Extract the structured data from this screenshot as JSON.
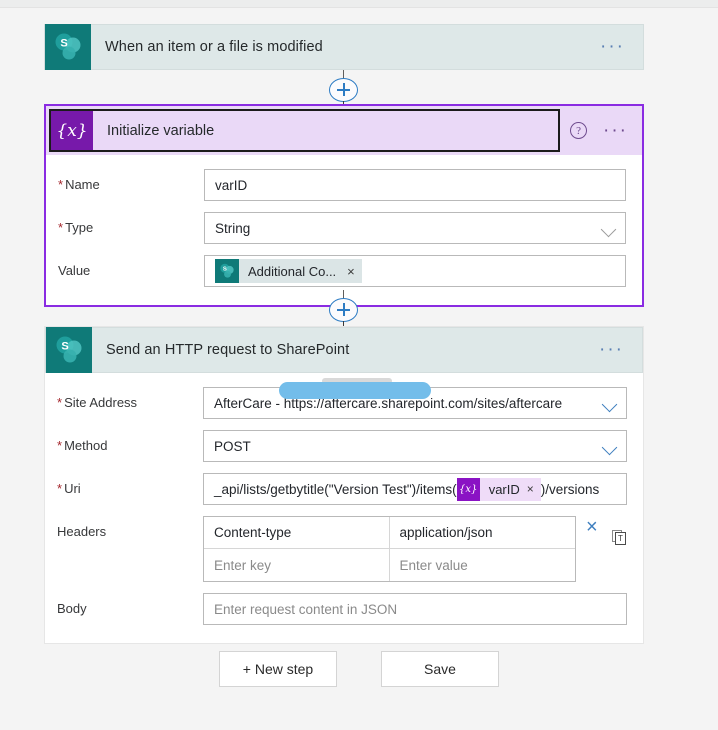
{
  "flow": {
    "trigger": {
      "icon": "sharepoint-icon",
      "title": "When an item or a file is modified",
      "menu": "···"
    },
    "init_variable": {
      "icon": "variable-braces-icon",
      "title": "Initialize variable",
      "help": "?",
      "menu": "···",
      "fields": {
        "name_label": "Name",
        "name_value": "varID",
        "type_label": "Type",
        "type_value": "String",
        "value_label": "Value",
        "value_token": "Additional Co...",
        "token_remove": "×"
      }
    },
    "http_request": {
      "icon": "sharepoint-icon",
      "title": "Send an HTTP request to SharePoint",
      "menu": "···",
      "fields": {
        "site_label": "Site Address",
        "site_value": "AfterCare - https://aftercare.sharepoint.com/sites/aftercare",
        "method_label": "Method",
        "method_value": "POST",
        "uri_label": "Uri",
        "uri_prefix": "_api/lists/getbytitle(\"Version Test\")/items(",
        "uri_token": "varID",
        "uri_token_remove": "×",
        "uri_suffix": ")/versions",
        "headers_label": "Headers",
        "header_rows": [
          {
            "key": "Content-type",
            "value": "application/json"
          }
        ],
        "header_key_placeholder": "Enter key",
        "header_value_placeholder": "Enter value",
        "header_delete": "×",
        "header_text_mode": "T",
        "body_label": "Body",
        "body_placeholder": "Enter request content in JSON"
      }
    },
    "connectors": [
      {
        "label": "+"
      },
      {
        "label": "+"
      }
    ]
  },
  "actions": {
    "new_step": "+ New step",
    "save": "Save"
  },
  "colors": {
    "sharepoint_teal": "#0f7a78",
    "trigger_card": "#dee8e8",
    "variable_purple": "#7719aa",
    "selected_border": "#8a2be2",
    "link_blue": "#2d7cc4",
    "required_red": "#a4262c",
    "redaction_blue": "#73bdea"
  }
}
